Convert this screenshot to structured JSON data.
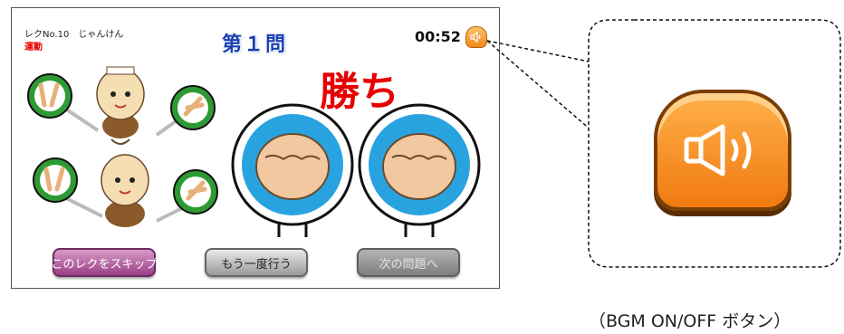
{
  "screen": {
    "lesson_label": "レクNo.10　じゃんけん",
    "category": "運動",
    "question_title": "第１問",
    "timer": "00:52",
    "result": "勝ち"
  },
  "buttons": {
    "skip": "このレクをスキップ",
    "retry": "もう一度行う",
    "next": "次の問題へ"
  },
  "icons": {
    "bgm_toggle": "speaker-icon",
    "peace_sign": "scissors-hand-icon",
    "fist": "rock-fist-icon"
  },
  "caption": "（BGM ON/OFF ボタン）",
  "colors": {
    "title_blue": "#1a3fb0",
    "result_red": "#e60000",
    "sign_green": "#2e9a33",
    "fist_circle_blue": "#29a3e0",
    "bgm_orange": "#f08a1a"
  }
}
